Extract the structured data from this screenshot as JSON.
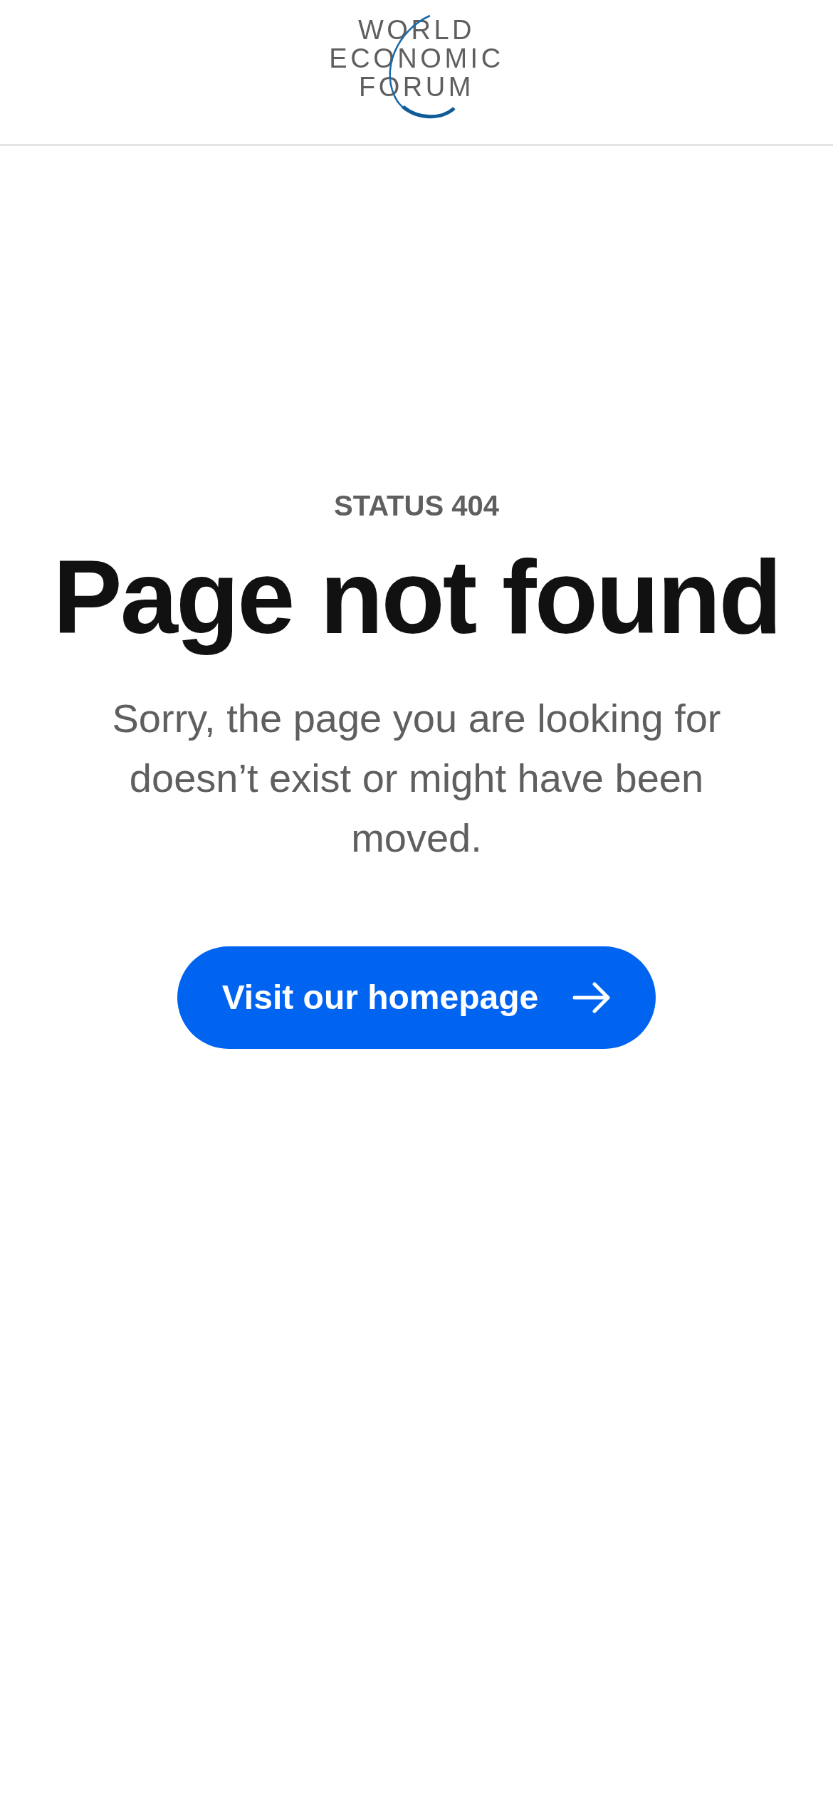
{
  "header": {
    "logo_lines": [
      "WORLD",
      "ECONOMIC",
      "FORUM"
    ]
  },
  "status": "STATUS 404",
  "heading": "Page not found",
  "message": "Sorry, the page you are looking for doesn’t exist or might have been moved.",
  "button": {
    "label": "Visit our homepage"
  }
}
